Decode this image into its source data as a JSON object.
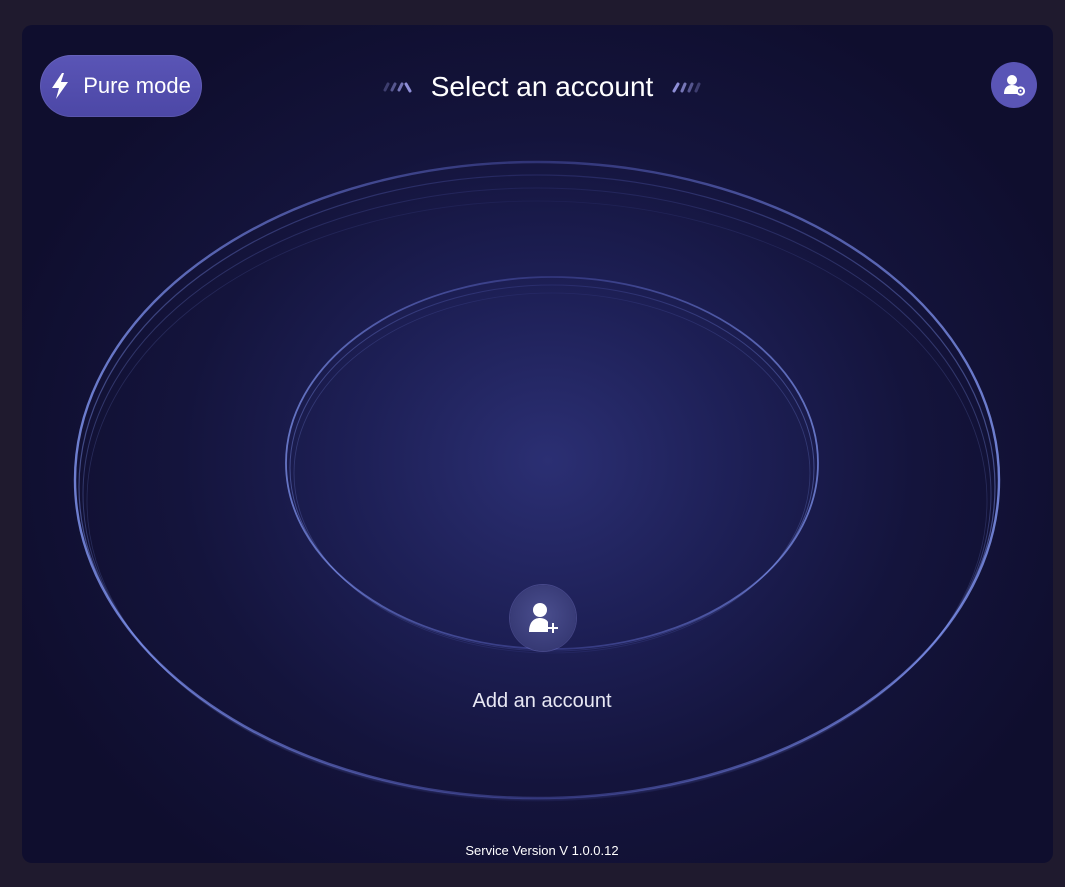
{
  "header": {
    "pure_mode_label": "Pure mode",
    "title": "Select an account"
  },
  "main": {
    "add_account_label": "Add an account"
  },
  "footer": {
    "version_text": "Service Version V 1.0.0.12"
  },
  "icons": {
    "pure_mode": "lightning-bolt-icon",
    "account_settings": "user-gear-icon",
    "add_account": "user-add-icon"
  },
  "colors": {
    "background": "#14143c",
    "accent": "#5a55b6",
    "text": "#ffffff"
  }
}
